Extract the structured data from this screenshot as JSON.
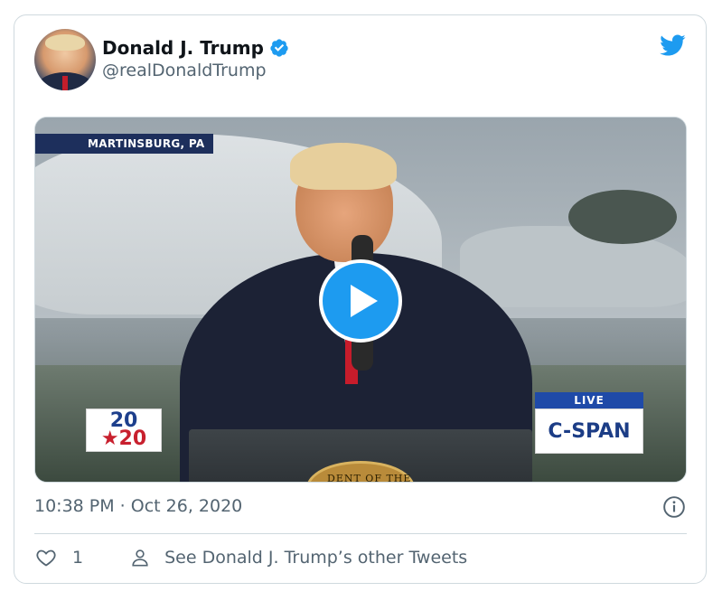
{
  "author": {
    "display_name": "Donald J. Trump",
    "handle": "@realDonaldTrump",
    "verified": true
  },
  "media": {
    "location_banner": "MARTINSBURG, PA",
    "badge_2020_top": "20",
    "badge_2020_bottom": "★20",
    "cspan_live": "LIVE",
    "cspan_logo": "C-SPAN",
    "seal_text": "DENT OF THE"
  },
  "tweet": {
    "timestamp": "10:38 PM · Oct 26, 2020"
  },
  "actions": {
    "like_count": "1",
    "other_tweets_label": "See Donald J. Trump’s other Tweets"
  },
  "colors": {
    "twitter_blue": "#1d9bf0",
    "secondary_text": "#536471",
    "border": "#cfd9de"
  },
  "icons": {
    "verified": "verified-badge-icon",
    "brand": "twitter-bird-icon",
    "play": "play-icon",
    "info": "info-icon",
    "like": "heart-icon",
    "profile": "person-icon"
  }
}
